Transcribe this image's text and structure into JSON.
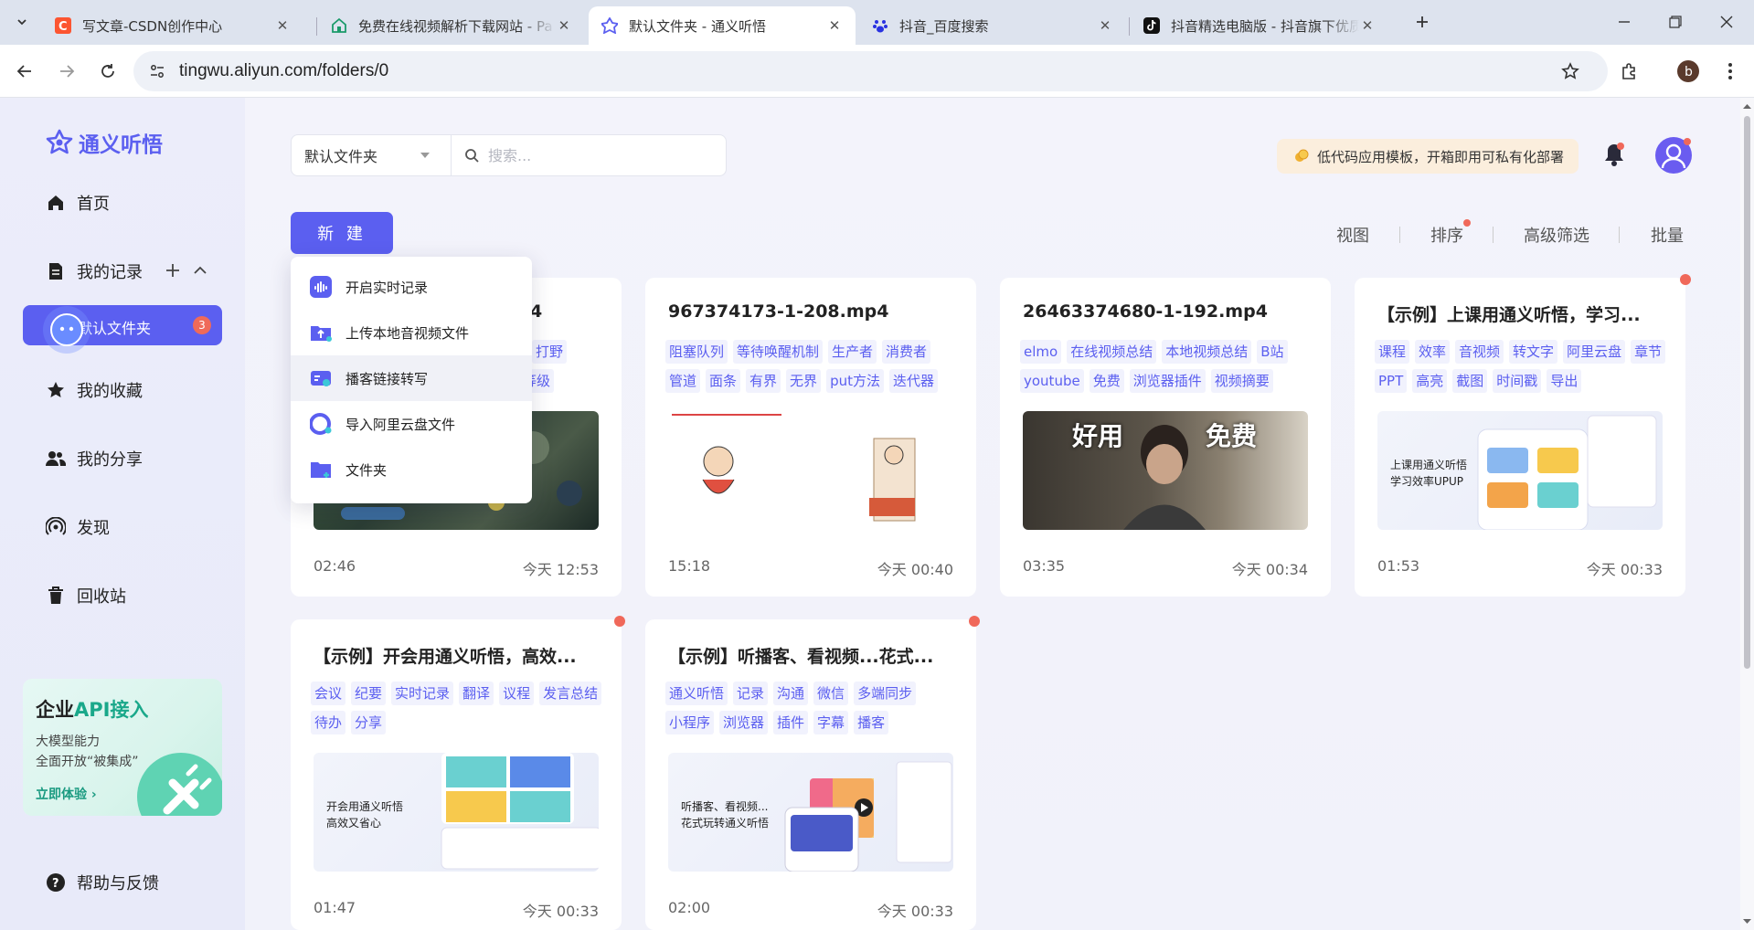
{
  "browser": {
    "tabs": [
      {
        "title": "写文章-CSDN创作中心",
        "favicon": "csdn-icon",
        "active": false
      },
      {
        "title": "免费在线视频解析下载网站 - Pa",
        "favicon": "house-icon",
        "active": false
      },
      {
        "title": "默认文件夹 - 通义听悟",
        "favicon": "tingwu-icon",
        "active": true
      },
      {
        "title": "抖音_百度搜索",
        "favicon": "baidu-paw-icon",
        "active": false
      },
      {
        "title": "抖音精选电脑版 - 抖音旗下优质",
        "favicon": "douyin-icon",
        "active": false
      }
    ],
    "url": "tingwu.aliyun.com/folders/0",
    "profile_initial": "b"
  },
  "sidebar": {
    "brand": "通义听悟",
    "nav": [
      {
        "label": "首页",
        "icon": "home-icon"
      },
      {
        "label": "我的记录",
        "icon": "document-icon"
      },
      {
        "label": "我的收藏",
        "icon": "star-icon"
      },
      {
        "label": "我的分享",
        "icon": "users-icon"
      },
      {
        "label": "发现",
        "icon": "broadcast-icon"
      },
      {
        "label": "回收站",
        "icon": "trash-icon"
      },
      {
        "label": "帮助与反馈",
        "icon": "help-icon"
      }
    ],
    "folder": {
      "label": "默认文件夹",
      "count": "3"
    },
    "api_card": {
      "title_a": "企业",
      "title_b": "API接入",
      "line1": "大模型能力",
      "line2": "全面开放“被集成”",
      "cta": "立即体验 ›"
    }
  },
  "header": {
    "folder_select": "默认文件夹",
    "search_placeholder": "搜索...",
    "promo": "低代码应用模板，开箱即用可私有化部署"
  },
  "toolbar": {
    "new_label": "新 建",
    "options": [
      "视图",
      "排序",
      "高级筛选",
      "批量"
    ]
  },
  "dropdown": {
    "items": [
      {
        "label": "开启实时记录",
        "icon": "realtime-record-icon"
      },
      {
        "label": "上传本地音视频文件",
        "icon": "upload-folder-icon"
      },
      {
        "label": "播客链接转写",
        "icon": "podcast-link-icon"
      },
      {
        "label": "导入阿里云盘文件",
        "icon": "aliyun-drive-icon"
      },
      {
        "label": "文件夹",
        "icon": "new-folder-icon"
      }
    ]
  },
  "cards": [
    {
      "title": "4",
      "tags": [
        "",
        "打野",
        "",
        "等级"
      ],
      "duration": "02:46",
      "time": "今天 12:53"
    },
    {
      "title": "967374173-1-208.mp4",
      "tags": [
        "阻塞队列",
        "等待唤醒机制",
        "生产者",
        "消费者",
        "管道",
        "面条",
        "有界",
        "无界",
        "put方法",
        "迭代器"
      ],
      "duration": "15:18",
      "time": "今天 00:40"
    },
    {
      "title": "26463374680-1-192.mp4",
      "tags": [
        "elmo",
        "在线视频总结",
        "本地视频总结",
        "B站",
        "youtube",
        "免费",
        "浏览器插件",
        "视频摘要"
      ],
      "duration": "03:35",
      "time": "今天 00:34",
      "thumb_text": [
        "好用",
        "免费"
      ]
    },
    {
      "title": "【示例】上课用通义听悟，学习...",
      "tags": [
        "课程",
        "效率",
        "音视频",
        "转文字",
        "阿里云盘",
        "章节",
        "PPT",
        "高亮",
        "截图",
        "时间戳",
        "导出"
      ],
      "duration": "01:53",
      "time": "今天 00:33",
      "thumb_text": [
        "上课用通义听悟",
        "学习效率UPUP"
      ]
    },
    {
      "title": "【示例】开会用通义听悟，高效...",
      "tags": [
        "会议",
        "纪要",
        "实时记录",
        "翻译",
        "议程",
        "发言总结",
        "待办",
        "分享"
      ],
      "duration": "01:47",
      "time": "今天 00:33",
      "thumb_text": [
        "开会用通义听悟",
        "高效又省心"
      ]
    },
    {
      "title": "【示例】听播客、看视频...花式...",
      "tags": [
        "通义听悟",
        "记录",
        "沟通",
        "微信",
        "多端同步",
        "小程序",
        "浏览器",
        "插件",
        "字幕",
        "播客"
      ],
      "duration": "02:00",
      "time": "今天 00:33",
      "thumb_text": [
        "听播客、看视频...",
        "花式玩转通义听悟"
      ]
    }
  ],
  "colors": {
    "accent": "#5b5ff0",
    "badge": "#ef6a5a",
    "promo_bg": "#fbeedd"
  }
}
